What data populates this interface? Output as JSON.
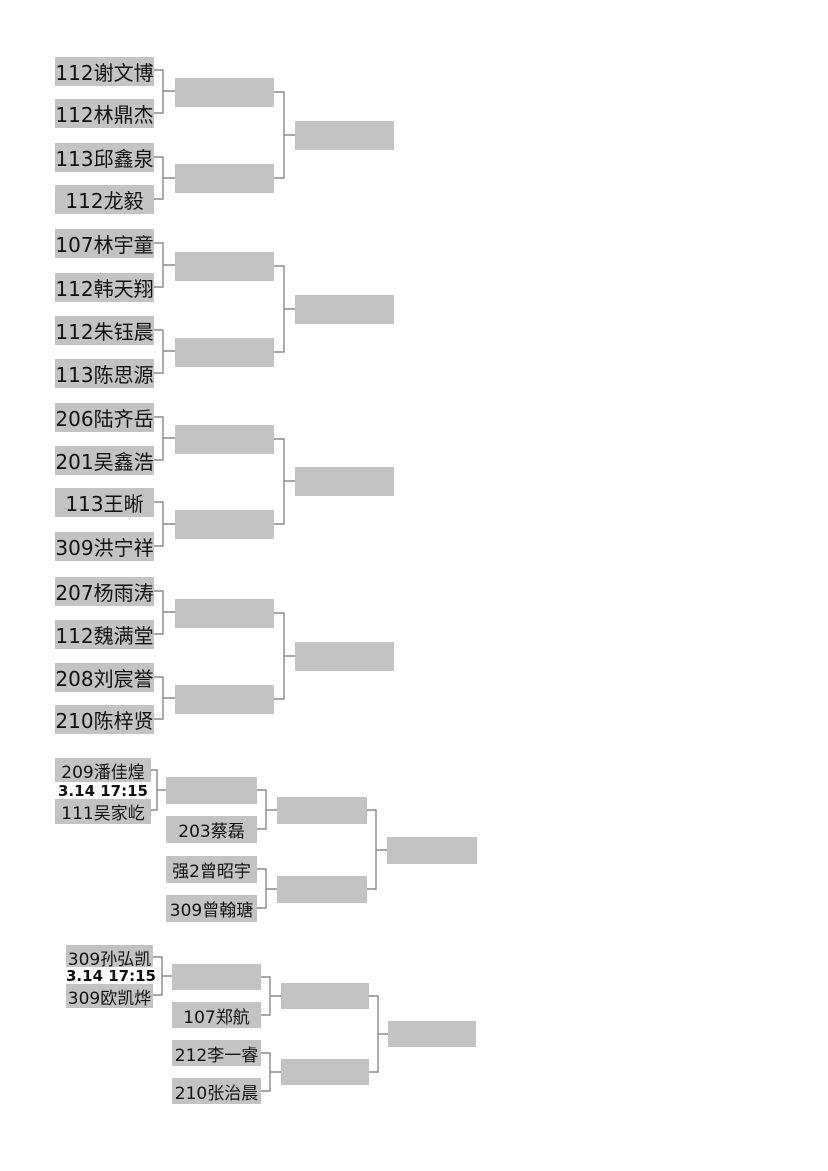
{
  "brackets": [
    {
      "players": [
        "112谢文博",
        "112林鼎杰",
        "113邱鑫泉",
        "112龙毅"
      ]
    },
    {
      "players": [
        "107林宇童",
        "112韩天翔",
        "112朱钰晨",
        "113陈思源"
      ]
    },
    {
      "players": [
        "206陆齐岳",
        "201吴鑫浩",
        "113王晰",
        "309洪宁祥"
      ]
    },
    {
      "players": [
        "207杨雨涛",
        "112魏满堂",
        "208刘宸誉",
        "210陈梓贤"
      ]
    },
    {
      "prelim": {
        "top": "209潘佳煌",
        "time": "3.14 17:15",
        "bottom": "111吴家屹"
      },
      "players": [
        "203蔡磊",
        "强2曾昭宇",
        "309曾翰瑭"
      ]
    },
    {
      "prelim": {
        "top": "309孙弘凯",
        "time": "3.14 17:15",
        "bottom": "309欧凯烨"
      },
      "players": [
        "107郑航",
        "212李一睿",
        "210张治晨"
      ]
    }
  ]
}
